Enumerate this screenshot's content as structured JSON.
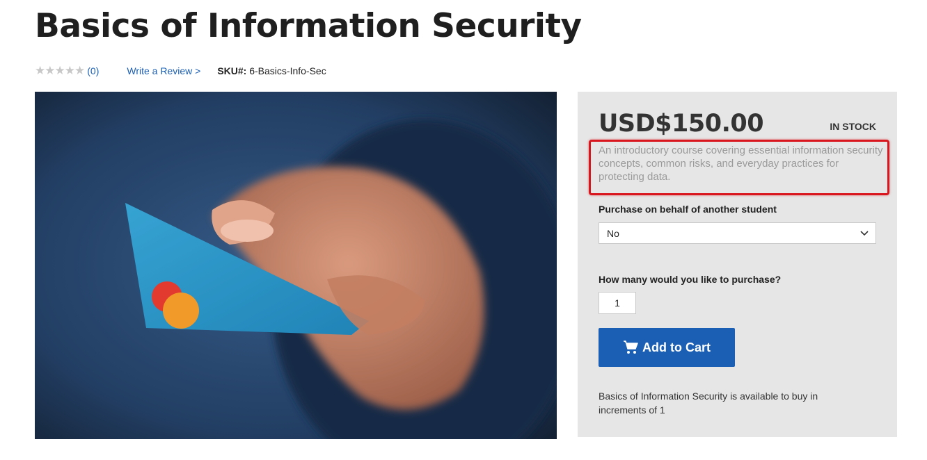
{
  "product": {
    "title": "Basics of Information Security",
    "rating_count": "(0)",
    "write_review": "Write a Review >",
    "sku_label": "SKU#:",
    "sku_value": "6-Basics-Info-Sec"
  },
  "image": {
    "alt_icon": "credit-card-photo"
  },
  "panel": {
    "price": "USD$150.00",
    "stock": "IN STOCK",
    "description": "An introductory course covering essential information security concepts, common risks, and everyday practices for protecting data.",
    "purchase_behalf_label": "Purchase on behalf of another student",
    "purchase_behalf_value": "No",
    "quantity_label": "How many would you like to purchase?",
    "quantity_value": "1",
    "add_to_cart": "Add to Cart",
    "increments_note": "Basics of Information Security is available to buy in increments of 1"
  },
  "colors": {
    "accent": "#1a5fb4",
    "highlight_border": "#d9161e",
    "panel_bg": "#e6e6e6"
  }
}
